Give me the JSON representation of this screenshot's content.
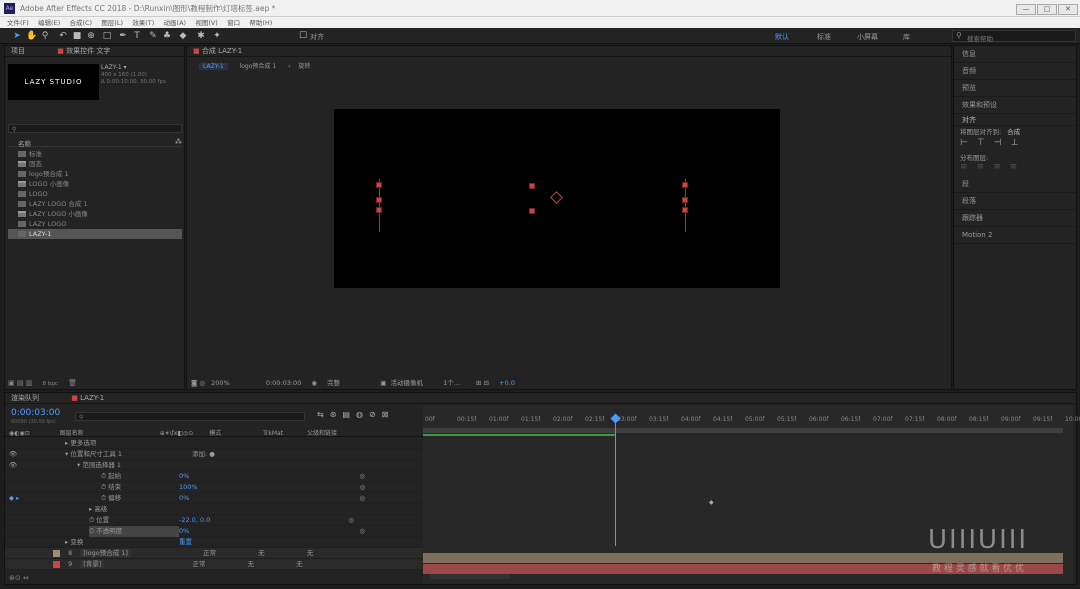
{
  "app": {
    "title": "Adobe After Effects CC 2018 - D:\\Runxin\\图形\\教程制作\\灯塔标签.aep *",
    "logo": "Ae",
    "min": "—",
    "max": "□",
    "close": "✕"
  },
  "menu": [
    "文件(F)",
    "编辑(E)",
    "合成(C)",
    "图层(L)",
    "效果(T)",
    "动画(A)",
    "视图(V)",
    "窗口",
    "帮助(H)"
  ],
  "toolbar": {
    "snap_label": "对齐",
    "workspaces": [
      "默认",
      "标准",
      "小屏幕",
      "库"
    ],
    "search_placeholder": "搜索帮助"
  },
  "project": {
    "tab_project": "项目",
    "tab_effects": "效果控件 文字",
    "thumb_text": "LAZY STUDIO",
    "comp_name": "LAZY-1 ▾",
    "comp_info1": "400 x 160 (1.00)",
    "comp_info2": "Δ 0:00:10:00, 30.00 fps",
    "col_name": "名称",
    "items": [
      {
        "type": "comp",
        "name": "标准"
      },
      {
        "type": "folder",
        "name": "固态"
      },
      {
        "type": "comp",
        "name": "logo预合成 1"
      },
      {
        "type": "folder",
        "name": "LOGO 小画像"
      },
      {
        "type": "comp",
        "name": "LOGO"
      },
      {
        "type": "comp",
        "name": "LAZY LOGO 合成 1"
      },
      {
        "type": "folder",
        "name": "LAZY LOGO 小画像"
      },
      {
        "type": "comp",
        "name": "LAZY LOGO"
      },
      {
        "type": "comp",
        "name": "LAZY-1"
      }
    ],
    "bottom_bpc": "8 bpc"
  },
  "comp": {
    "tab": "合成 LAZY-1",
    "crumb1": "LAZY-1",
    "crumb2": "logo预合成 1",
    "crumb3": "旋转",
    "zoom": "200%",
    "time": "0:00:03:00",
    "quality": "完整",
    "camera": "活动摄像机",
    "views": "1个...",
    "exposure": "+0.0"
  },
  "right": {
    "items": [
      "信息",
      "音频",
      "预览",
      "效果和预设"
    ],
    "align_title": "对齐",
    "align_to_label": "将图层对齐到:",
    "align_to_value": "合成",
    "distribute_label": "分布图层:",
    "items2": [
      "段",
      "段落",
      "跟踪器",
      "Motion 2"
    ]
  },
  "timeline": {
    "tab_render": "渲染队列",
    "tab_comp": "LAZY-1",
    "timecode": "0:00:03:00",
    "timecode_sub": "00090 (30.00 fps)",
    "cols": {
      "name": "图层名称",
      "mode": "模式",
      "trkmat": "TrkMat",
      "parent": "父级和链接"
    },
    "ticks": [
      "00f",
      "00:15f",
      "01:00f",
      "01:15f",
      "02:00f",
      "02:15f",
      "03:00f",
      "03:15f",
      "04:00f",
      "04:15f",
      "05:00f",
      "05:15f",
      "06:00f",
      "06:15f",
      "07:00f",
      "07:15f",
      "08:00f",
      "08:15f",
      "09:00f",
      "09:15f",
      "10:00f"
    ],
    "rows": [
      {
        "indent": 60,
        "label": "▸ 更多选项",
        "val": ""
      },
      {
        "indent": 60,
        "label": "▾ 位置和尺寸工具 1",
        "val": "添加: ●"
      },
      {
        "indent": 72,
        "label": "▾ 范围选择器 1",
        "val": ""
      },
      {
        "indent": 96,
        "label": "⏱ 起始",
        "val": "0%"
      },
      {
        "indent": 96,
        "label": "⏱ 结束",
        "val": "100%"
      },
      {
        "indent": 96,
        "label": "⏱ 偏移",
        "val": "0%"
      },
      {
        "indent": 84,
        "label": "▸ 高级",
        "val": ""
      },
      {
        "indent": 84,
        "label": "⏱ 位置",
        "val": "-22.0, 0.0"
      },
      {
        "indent": 84,
        "label": "⏱ 不透明度",
        "val": "0%"
      },
      {
        "indent": 60,
        "label": "▸ 变换",
        "val": "重置"
      }
    ],
    "layers": [
      {
        "num": "8",
        "name": "[logo预合成 1]",
        "mode": "正常",
        "trk": "无",
        "parent": "无"
      },
      {
        "num": "9",
        "name": "[背景]",
        "mode": "正常",
        "trk": "无",
        "parent": "无"
      }
    ]
  },
  "watermark": {
    "brand": "UIIIUIII",
    "tagline": "教 程 灵 感 就 看 优 优"
  }
}
